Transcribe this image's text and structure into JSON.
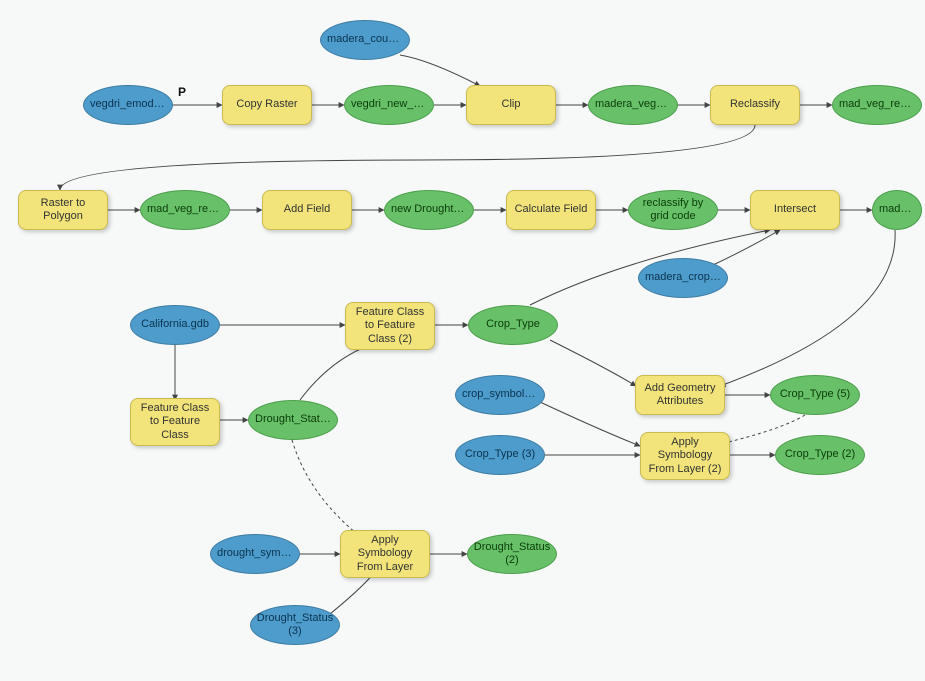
{
  "labels": {
    "p": "P"
  },
  "nodes": {
    "vegdri_emodis": "vegdri_emodis...",
    "copy_raster": "Copy Raster",
    "vegdri_new_grid": "vegdri_new_grid",
    "madera_count": "madera_count...",
    "clip": "Clip",
    "madera_vegdr": "madera_vegdr...",
    "reclassify": "Reclassify",
    "mad_veg_recl_1": "mad_veg_recl...",
    "raster_to_polygon": "Raster to Polygon",
    "mad_veg_recl_2": "mad_veg_recl...",
    "add_field": "Add Field",
    "new_drought_field": "new Drought field",
    "calculate_field": "Calculate Field",
    "reclassify_by_grid": "reclassify by grid code",
    "intersect": "Intersect",
    "mad_veg_crop": "mad_veg_crop...",
    "madera_crops": "madera_crops...",
    "california_gdb": "California.gdb",
    "fc_to_fc": "Feature Class to Feature Class",
    "fc_to_fc_2": "Feature Class to Feature Class (2)",
    "drought_status": "Drought_Status",
    "crop_type": "Crop_Type",
    "crop_symbology": "crop_symbology",
    "add_geom_attr": "Add Geometry Attributes",
    "crop_type_5": "Crop_Type (5)",
    "crop_type_3": "Crop_Type (3)",
    "apply_symb_2": "Apply Symbology From Layer (2)",
    "crop_type_2": "Crop_Type (2)",
    "drought_symb": "drought_symb...",
    "apply_symb": "Apply Symbology From Layer",
    "drought_status_2": "Drought_Status (2)",
    "drought_status_3": "Drought_Status (3)"
  }
}
